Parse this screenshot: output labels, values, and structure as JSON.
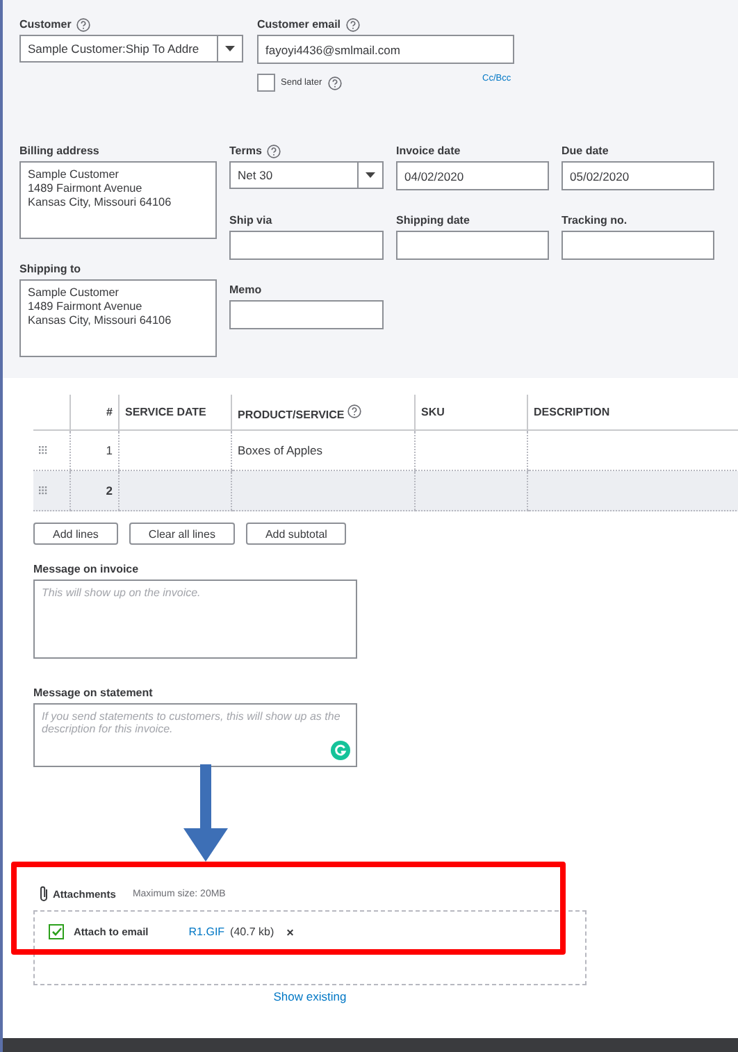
{
  "customer": {
    "label": "Customer",
    "help": true,
    "value": "Sample Customer:Ship To Addre"
  },
  "customer_email": {
    "label": "Customer email",
    "help": true,
    "value": "fayoyi4436@smlmail.com"
  },
  "send_later": {
    "label": "Send later",
    "help": true,
    "checked": false
  },
  "cc_bcc": "Cc/Bcc",
  "billing_address": {
    "label": "Billing address",
    "lines": [
      "Sample Customer",
      "1489  Fairmont Avenue",
      "Kansas City, Missouri  64106"
    ]
  },
  "shipping_to": {
    "label": "Shipping to",
    "lines": [
      "Sample Customer",
      "1489  Fairmont Avenue",
      "Kansas City, Missouri  64106"
    ]
  },
  "terms": {
    "label": "Terms",
    "help": true,
    "value": "Net 30"
  },
  "invoice_date": {
    "label": "Invoice date",
    "value": "04/02/2020"
  },
  "due_date": {
    "label": "Due date",
    "value": "05/02/2020"
  },
  "ship_via": {
    "label": "Ship via"
  },
  "shipping_date": {
    "label": "Shipping date"
  },
  "tracking_no": {
    "label": "Tracking no."
  },
  "memo": {
    "label": "Memo"
  },
  "table": {
    "columns": [
      {
        "label": "#",
        "help": false
      },
      {
        "label": "SERVICE DATE",
        "help": false
      },
      {
        "label": "PRODUCT/SERVICE",
        "help": true
      },
      {
        "label": "SKU",
        "help": false
      },
      {
        "label": "DESCRIPTION",
        "help": false
      }
    ],
    "rows": [
      {
        "number": "1",
        "product": "Boxes of Apples",
        "selected": false
      },
      {
        "number": "2",
        "selected": true
      }
    ]
  },
  "table_buttons": [
    "Add lines",
    "Clear all lines",
    "Add subtotal"
  ],
  "message_on_invoice": {
    "label": "Message on invoice",
    "placeholder": "This will show up on the invoice."
  },
  "message_on_statement": {
    "label": "Message on statement",
    "placeholder": "If you send statements to customers, this will show up as the description for this invoice."
  },
  "attachments": {
    "label": "Attachments",
    "max_size": "Maximum size: 20MB",
    "attach_to_email": {
      "label": "Attach to email",
      "checked": true
    },
    "file_name": "R1.GIF",
    "file_size": "(40.7 kb)",
    "remove": "×"
  },
  "show_existing": "Show existing"
}
